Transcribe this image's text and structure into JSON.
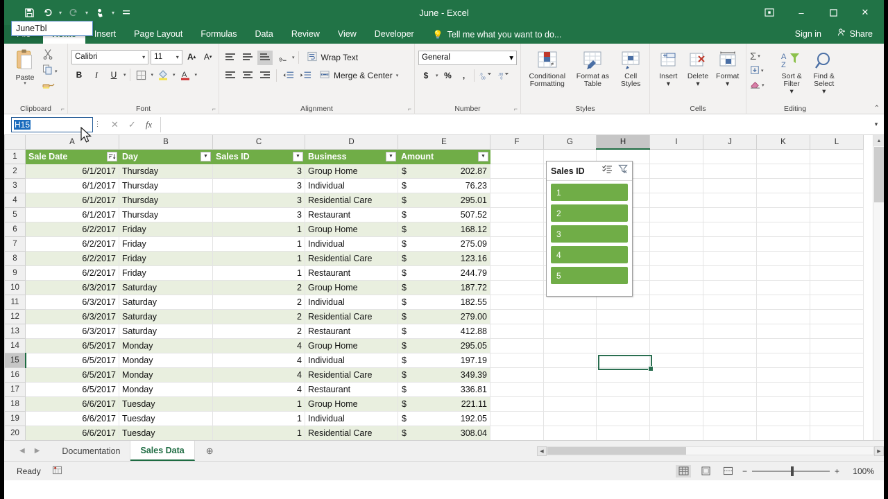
{
  "window": {
    "title": "June - Excel",
    "quick_access": [
      "save-icon",
      "undo-icon",
      "redo-icon",
      "touch-mode-icon",
      "customize-qat-icon"
    ],
    "controls": {
      "ribbon_display": "ribbon-display-icon",
      "minimize": "–",
      "maximize": "❐",
      "close": "✕"
    }
  },
  "ribbon": {
    "tabs": [
      {
        "label": "File"
      },
      {
        "label": "Home"
      },
      {
        "label": "Insert"
      },
      {
        "label": "Page Layout"
      },
      {
        "label": "Formulas"
      },
      {
        "label": "Data"
      },
      {
        "label": "Review"
      },
      {
        "label": "View"
      },
      {
        "label": "Developer"
      }
    ],
    "active_tab": "Home",
    "tell_me": "Tell me what you want to do...",
    "sign_in": "Sign in",
    "share": "Share",
    "groups": {
      "clipboard": {
        "label": "Clipboard",
        "paste": "Paste",
        "cut": "cut-icon",
        "copy": "copy-icon",
        "format_painter": "format-painter-icon"
      },
      "font": {
        "label": "Font",
        "font_name": "Calibri",
        "font_size": "11",
        "grow_font": "A",
        "shrink_font": "A",
        "bold": "B",
        "italic": "I",
        "underline": "U",
        "borders": "borders-icon",
        "fill_color": "fill-color-icon",
        "font_color": "A"
      },
      "alignment": {
        "label": "Alignment",
        "wrap_text": "Wrap Text",
        "merge_center": "Merge & Center"
      },
      "number": {
        "label": "Number",
        "format": "General",
        "accounting": "$",
        "percent": "%",
        "comma": ",",
        "increase_decimal": "increase-decimal-icon",
        "decrease_decimal": "decrease-decimal-icon"
      },
      "styles": {
        "label": "Styles",
        "conditional_formatting": "Conditional Formatting",
        "format_as_table": "Format as Table",
        "cell_styles": "Cell Styles"
      },
      "cells": {
        "label": "Cells",
        "insert": "Insert",
        "delete": "Delete",
        "format": "Format"
      },
      "editing": {
        "label": "Editing",
        "autosum": "Σ",
        "fill": "fill-icon",
        "clear": "clear-icon",
        "sort_filter": "Sort & Filter",
        "find_select": "Find & Select"
      }
    }
  },
  "formula_bar": {
    "name_box_value": "H15",
    "name_box_dropdown_item": "JuneTbl",
    "cancel": "✕",
    "enter": "✓",
    "insert_function": "fx",
    "formula_value": ""
  },
  "grid": {
    "columns": [
      "A",
      "B",
      "C",
      "D",
      "E",
      "F",
      "G",
      "H",
      "I",
      "J",
      "K",
      "L"
    ],
    "selected_column": "H",
    "selected_cell": "H15",
    "row_numbers": [
      "1",
      "2",
      "3",
      "4",
      "5",
      "6",
      "7",
      "8",
      "9",
      "10",
      "11",
      "12",
      "13",
      "14",
      "15",
      "16",
      "17",
      "18",
      "19",
      "20"
    ],
    "table_headers": [
      "Sale Date",
      "Day",
      "Sales ID",
      "Business",
      "Amount"
    ],
    "rows": [
      {
        "n": "2",
        "date": "6/1/2017",
        "day": "Thursday",
        "id": "3",
        "business": "Group Home",
        "cur": "$",
        "amount": "202.87"
      },
      {
        "n": "3",
        "date": "6/1/2017",
        "day": "Thursday",
        "id": "3",
        "business": "Individual",
        "cur": "$",
        "amount": "76.23"
      },
      {
        "n": "4",
        "date": "6/1/2017",
        "day": "Thursday",
        "id": "3",
        "business": "Residential Care",
        "cur": "$",
        "amount": "295.01"
      },
      {
        "n": "5",
        "date": "6/1/2017",
        "day": "Thursday",
        "id": "3",
        "business": "Restaurant",
        "cur": "$",
        "amount": "507.52"
      },
      {
        "n": "6",
        "date": "6/2/2017",
        "day": "Friday",
        "id": "1",
        "business": "Group Home",
        "cur": "$",
        "amount": "168.12"
      },
      {
        "n": "7",
        "date": "6/2/2017",
        "day": "Friday",
        "id": "1",
        "business": "Individual",
        "cur": "$",
        "amount": "275.09"
      },
      {
        "n": "8",
        "date": "6/2/2017",
        "day": "Friday",
        "id": "1",
        "business": "Residential Care",
        "cur": "$",
        "amount": "123.16"
      },
      {
        "n": "9",
        "date": "6/2/2017",
        "day": "Friday",
        "id": "1",
        "business": "Restaurant",
        "cur": "$",
        "amount": "244.79"
      },
      {
        "n": "10",
        "date": "6/3/2017",
        "day": "Saturday",
        "id": "2",
        "business": "Group Home",
        "cur": "$",
        "amount": "187.72"
      },
      {
        "n": "11",
        "date": "6/3/2017",
        "day": "Saturday",
        "id": "2",
        "business": "Individual",
        "cur": "$",
        "amount": "182.55"
      },
      {
        "n": "12",
        "date": "6/3/2017",
        "day": "Saturday",
        "id": "2",
        "business": "Residential Care",
        "cur": "$",
        "amount": "279.00"
      },
      {
        "n": "13",
        "date": "6/3/2017",
        "day": "Saturday",
        "id": "2",
        "business": "Restaurant",
        "cur": "$",
        "amount": "412.88"
      },
      {
        "n": "14",
        "date": "6/5/2017",
        "day": "Monday",
        "id": "4",
        "business": "Group Home",
        "cur": "$",
        "amount": "295.05"
      },
      {
        "n": "15",
        "date": "6/5/2017",
        "day": "Monday",
        "id": "4",
        "business": "Individual",
        "cur": "$",
        "amount": "197.19"
      },
      {
        "n": "16",
        "date": "6/5/2017",
        "day": "Monday",
        "id": "4",
        "business": "Residential Care",
        "cur": "$",
        "amount": "349.39"
      },
      {
        "n": "17",
        "date": "6/5/2017",
        "day": "Monday",
        "id": "4",
        "business": "Restaurant",
        "cur": "$",
        "amount": "336.81"
      },
      {
        "n": "18",
        "date": "6/6/2017",
        "day": "Tuesday",
        "id": "1",
        "business": "Group Home",
        "cur": "$",
        "amount": "221.11"
      },
      {
        "n": "19",
        "date": "6/6/2017",
        "day": "Tuesday",
        "id": "1",
        "business": "Individual",
        "cur": "$",
        "amount": "192.05"
      },
      {
        "n": "20",
        "date": "6/6/2017",
        "day": "Tuesday",
        "id": "1",
        "business": "Residential Care",
        "cur": "$",
        "amount": "308.04"
      }
    ]
  },
  "slicer": {
    "title": "Sales ID",
    "multiselect_icon": "multi-select-icon",
    "clear_filter_icon": "clear-filter-icon",
    "items": [
      "1",
      "2",
      "3",
      "4",
      "5"
    ],
    "item_color": "#70ad47"
  },
  "sheet_tabs": {
    "tabs": [
      "Documentation",
      "Sales Data"
    ],
    "active": "Sales Data",
    "add_label": "⊕"
  },
  "status_bar": {
    "state": "Ready",
    "macro_icon": "record-macro-icon",
    "views": [
      "normal-view-icon",
      "page-layout-view-icon",
      "page-break-view-icon"
    ],
    "active_view": "normal-view-icon",
    "zoom_out": "−",
    "zoom_in": "+",
    "zoom": "100%"
  },
  "theme": {
    "excel_green": "#217346",
    "table_header_green": "#70ad47",
    "band_green": "#e9efdf",
    "selection_green": "#2a6e50"
  }
}
